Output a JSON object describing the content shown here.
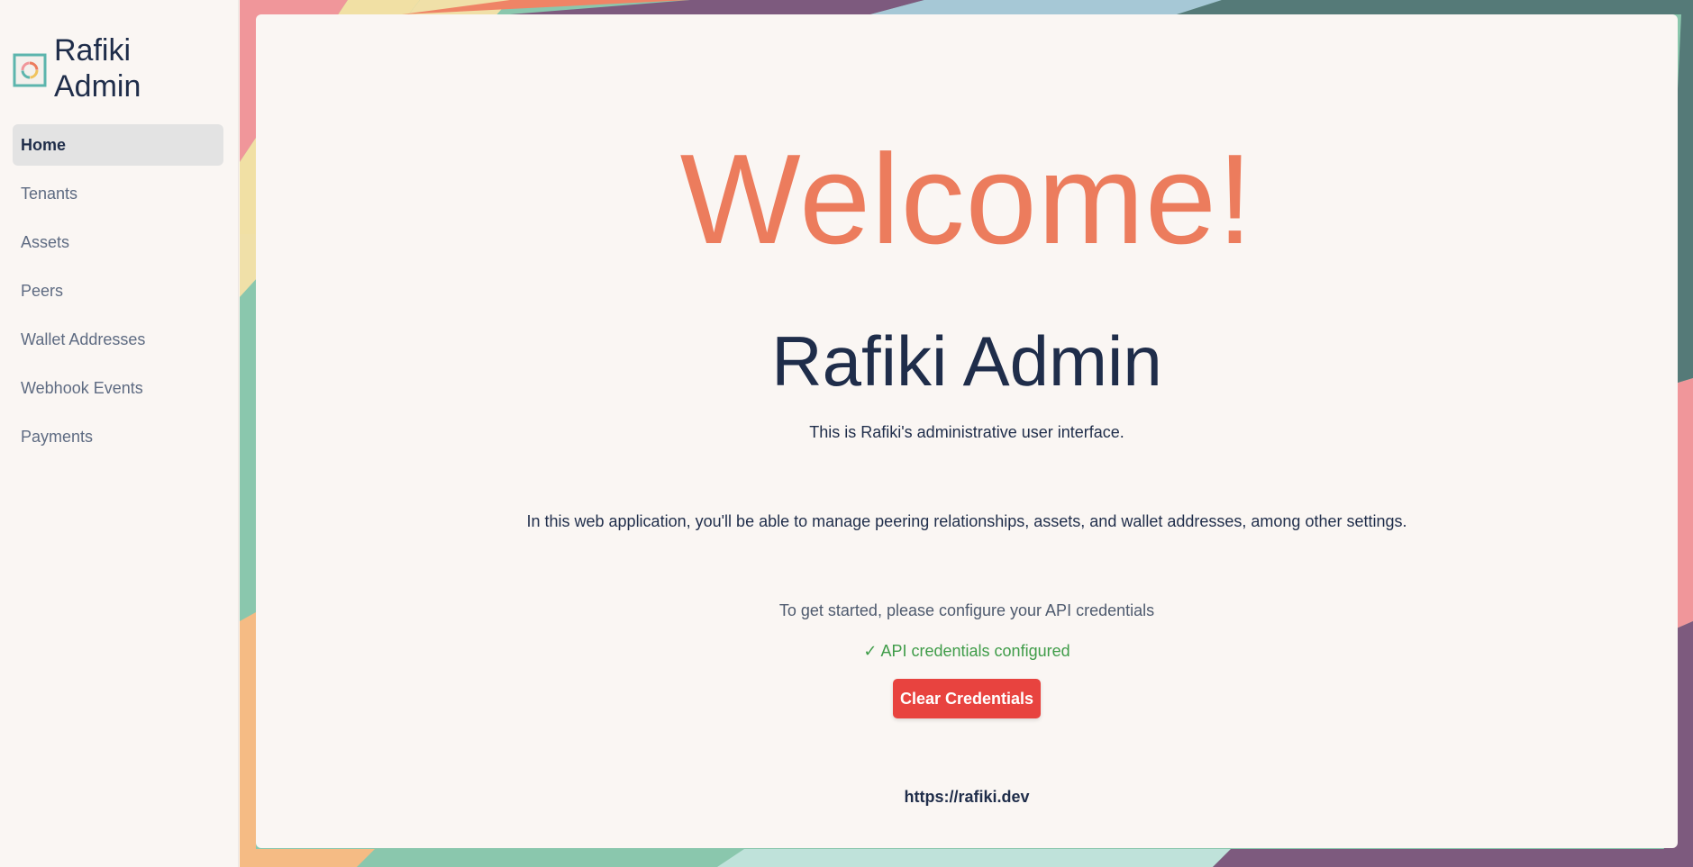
{
  "sidebar": {
    "brand": "Rafiki Admin",
    "items": [
      {
        "label": "Home",
        "active": true
      },
      {
        "label": "Tenants",
        "active": false
      },
      {
        "label": "Assets",
        "active": false
      },
      {
        "label": "Peers",
        "active": false
      },
      {
        "label": "Wallet Addresses",
        "active": false
      },
      {
        "label": "Webhook Events",
        "active": false
      },
      {
        "label": "Payments",
        "active": false
      }
    ]
  },
  "main": {
    "welcome": "Welcome!",
    "title": "Rafiki Admin",
    "intro": "This is Rafiki's administrative user interface.",
    "description": "In this web application, you'll be able to manage peering relationships, assets, and wallet addresses, among other settings.",
    "getting_started": "To get started, please configure your API credentials",
    "status": "✓ API credentials configured",
    "clear_button": "Clear Credentials",
    "link": "https://rafiki.dev"
  },
  "colors": {
    "accent": "#ec7c5d",
    "text": "#1f2d4a",
    "success": "#3f9c49",
    "danger": "#e8433f",
    "nav_active_bg": "#e3e3e3"
  },
  "icons": {
    "brand": "rafiki-logo-icon"
  }
}
